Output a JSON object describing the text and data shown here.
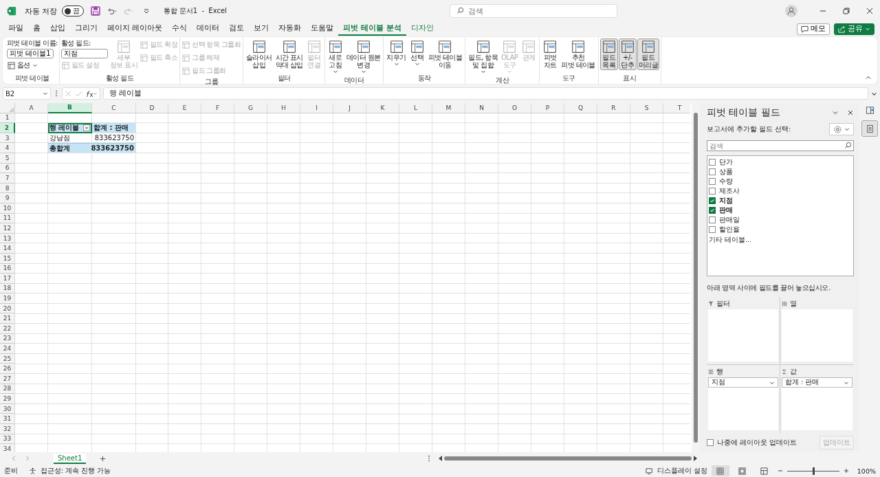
{
  "title_bar": {
    "autosave_label": "자동 저장",
    "autosave_state": "끔",
    "autosave_on": false,
    "document_title": "통합 문서1  -  Excel",
    "search_placeholder": "검색"
  },
  "menu_tabs": [
    {
      "label": "파일",
      "selected": false,
      "kind": "standard"
    },
    {
      "label": "홈",
      "selected": false,
      "kind": "standard"
    },
    {
      "label": "삽입",
      "selected": false,
      "kind": "standard"
    },
    {
      "label": "그리기",
      "selected": false,
      "kind": "standard"
    },
    {
      "label": "페이지 레이아웃",
      "selected": false,
      "kind": "standard"
    },
    {
      "label": "수식",
      "selected": false,
      "kind": "standard"
    },
    {
      "label": "데이터",
      "selected": false,
      "kind": "standard"
    },
    {
      "label": "검토",
      "selected": false,
      "kind": "standard"
    },
    {
      "label": "보기",
      "selected": false,
      "kind": "standard"
    },
    {
      "label": "자동화",
      "selected": false,
      "kind": "standard"
    },
    {
      "label": "도움말",
      "selected": false,
      "kind": "standard"
    },
    {
      "label": "피벗 테이블 분석",
      "selected": true,
      "kind": "contextual"
    },
    {
      "label": "디자인",
      "selected": false,
      "kind": "contextual"
    }
  ],
  "comment_button": "메모",
  "share_button": "공유",
  "ribbon_groups": [
    {
      "label": "피벗 테이블",
      "columns": [
        [
          {
            "kind": "field",
            "label": "피벗 테이블 이름:",
            "value": "피벗 테이블1"
          },
          {
            "kind": "small",
            "label": "옵션",
            "caret": true,
            "disabled": false
          }
        ]
      ]
    },
    {
      "label": "활성 필드",
      "columns": [
        [
          {
            "kind": "field",
            "label": "활성 필드:",
            "value": "지점"
          },
          {
            "kind": "small",
            "label": "필드 설정",
            "disabled": true
          }
        ],
        [
          {
            "kind": "large",
            "lines": [
              "세부",
              "정보 표시"
            ],
            "disabled": true,
            "pressed": false
          }
        ],
        [
          {
            "kind": "small",
            "label": "필드 확장",
            "disabled": true
          },
          {
            "kind": "small",
            "label": "필드 축소",
            "disabled": true
          }
        ]
      ]
    },
    {
      "label": "그룹",
      "columns": [
        [
          {
            "kind": "small",
            "label": "선택 항목 그룹화",
            "disabled": true
          },
          {
            "kind": "small",
            "label": "그룹 해제",
            "disabled": true
          },
          {
            "kind": "small",
            "label": "필드 그룹화",
            "disabled": true
          }
        ]
      ]
    },
    {
      "label": "필터",
      "columns": [
        [
          {
            "kind": "large",
            "lines": [
              "슬라이서",
              "삽입"
            ],
            "disabled": false,
            "pressed": false
          }
        ],
        [
          {
            "kind": "large",
            "lines": [
              "시간 표시",
              "막대 삽입"
            ],
            "disabled": false,
            "pressed": false
          }
        ],
        [
          {
            "kind": "large",
            "lines": [
              "필터",
              "연결"
            ],
            "disabled": true,
            "pressed": false
          }
        ]
      ]
    },
    {
      "label": "데이터",
      "columns": [
        [
          {
            "kind": "large",
            "lines": [
              "새로",
              "고침"
            ],
            "caret": true,
            "disabled": false,
            "pressed": false
          }
        ],
        [
          {
            "kind": "large",
            "lines": [
              "데이터 원본",
              "변경"
            ],
            "caret": true,
            "disabled": false,
            "pressed": false
          }
        ]
      ]
    },
    {
      "label": "동작",
      "columns": [
        [
          {
            "kind": "large",
            "lines": [
              "지우기"
            ],
            "caret": true,
            "disabled": false,
            "pressed": false
          }
        ],
        [
          {
            "kind": "large",
            "lines": [
              "선택"
            ],
            "caret": true,
            "disabled": false,
            "pressed": false
          }
        ],
        [
          {
            "kind": "large",
            "lines": [
              "피벗 테이블",
              "이동"
            ],
            "disabled": false,
            "pressed": false
          }
        ]
      ]
    },
    {
      "label": "계산",
      "columns": [
        [
          {
            "kind": "large",
            "lines": [
              "필드, 항목",
              "및 집합"
            ],
            "caret": true,
            "disabled": false,
            "pressed": false
          }
        ],
        [
          {
            "kind": "large",
            "lines": [
              "OLAP",
              "도구"
            ],
            "caret": true,
            "disabled": true,
            "pressed": false
          }
        ],
        [
          {
            "kind": "large",
            "lines": [
              "관계"
            ],
            "disabled": true,
            "pressed": false
          }
        ]
      ]
    },
    {
      "label": "도구",
      "columns": [
        [
          {
            "kind": "large",
            "lines": [
              "피벗",
              "차트"
            ],
            "disabled": false,
            "pressed": false
          }
        ],
        [
          {
            "kind": "large",
            "lines": [
              "추천",
              "피벗 테이블"
            ],
            "disabled": false,
            "pressed": false
          }
        ]
      ]
    },
    {
      "label": "표시",
      "columns": [
        [
          {
            "kind": "large",
            "lines": [
              "필드",
              "목록"
            ],
            "disabled": false,
            "pressed": true
          }
        ],
        [
          {
            "kind": "large",
            "lines": [
              "+/-",
              "단추"
            ],
            "disabled": false,
            "pressed": true
          }
        ],
        [
          {
            "kind": "large",
            "lines": [
              "필드",
              "머리글"
            ],
            "disabled": false,
            "pressed": true
          }
        ]
      ]
    }
  ],
  "formula_bar": {
    "name_box": "B2",
    "formula": "행 레이블"
  },
  "columns": [
    {
      "label": "A",
      "selected": false
    },
    {
      "label": "B",
      "selected": true
    },
    {
      "label": "C",
      "selected": false
    },
    {
      "label": "D",
      "selected": false
    },
    {
      "label": "E",
      "selected": false
    },
    {
      "label": "F",
      "selected": false
    },
    {
      "label": "G",
      "selected": false
    },
    {
      "label": "H",
      "selected": false
    },
    {
      "label": "I",
      "selected": false
    },
    {
      "label": "J",
      "selected": false
    },
    {
      "label": "K",
      "selected": false
    },
    {
      "label": "L",
      "selected": false
    },
    {
      "label": "M",
      "selected": false
    },
    {
      "label": "N",
      "selected": false
    },
    {
      "label": "O",
      "selected": false
    },
    {
      "label": "P",
      "selected": false
    },
    {
      "label": "Q",
      "selected": false
    },
    {
      "label": "R",
      "selected": false
    },
    {
      "label": "S",
      "selected": false
    },
    {
      "label": "T",
      "selected": false
    }
  ],
  "rows": [
    {
      "label": "1",
      "selected": false
    },
    {
      "label": "2",
      "selected": true
    },
    {
      "label": "3",
      "selected": false
    },
    {
      "label": "4",
      "selected": false
    },
    {
      "label": "5",
      "selected": false
    },
    {
      "label": "6",
      "selected": false
    },
    {
      "label": "7",
      "selected": false
    },
    {
      "label": "8",
      "selected": false
    },
    {
      "label": "9",
      "selected": false
    },
    {
      "label": "10",
      "selected": false
    },
    {
      "label": "11",
      "selected": false
    },
    {
      "label": "12",
      "selected": false
    },
    {
      "label": "13",
      "selected": false
    },
    {
      "label": "14",
      "selected": false
    },
    {
      "label": "15",
      "selected": false
    },
    {
      "label": "16",
      "selected": false
    },
    {
      "label": "17",
      "selected": false
    },
    {
      "label": "18",
      "selected": false
    },
    {
      "label": "19",
      "selected": false
    },
    {
      "label": "20",
      "selected": false
    },
    {
      "label": "21",
      "selected": false
    },
    {
      "label": "22",
      "selected": false
    },
    {
      "label": "23",
      "selected": false
    },
    {
      "label": "24",
      "selected": false
    },
    {
      "label": "25",
      "selected": false
    },
    {
      "label": "26",
      "selected": false
    },
    {
      "label": "27",
      "selected": false
    },
    {
      "label": "28",
      "selected": false
    },
    {
      "label": "29",
      "selected": false
    },
    {
      "label": "30",
      "selected": false
    },
    {
      "label": "31",
      "selected": false
    },
    {
      "label": "32",
      "selected": false
    },
    {
      "label": "33",
      "selected": false
    },
    {
      "label": "34",
      "selected": false
    }
  ],
  "pivot": {
    "header": [
      "행 레이블",
      "합계 : 판매"
    ],
    "rows": [
      [
        "강남점",
        "833623750"
      ]
    ],
    "total": [
      "총합계",
      "833623750"
    ]
  },
  "sheet_tabs": [
    {
      "label": "Sheet1",
      "selected": true
    }
  ],
  "field_pane": {
    "title": "피벗 테이블 필드",
    "subtitle": "보고서에 추가할 필드 선택:",
    "search_placeholder": "검색",
    "fields": [
      {
        "label": "단가",
        "checked": false
      },
      {
        "label": "상품",
        "checked": false
      },
      {
        "label": "수량",
        "checked": false
      },
      {
        "label": "제조사",
        "checked": false
      },
      {
        "label": "지점",
        "checked": true
      },
      {
        "label": "판매",
        "checked": true
      },
      {
        "label": "판매일",
        "checked": false
      },
      {
        "label": "할인율",
        "checked": false
      }
    ],
    "more_tables": "기타 테이블...",
    "hint": "아래 영역 사이에 필드를 끌어 놓으십시오.",
    "areas": [
      {
        "label": "필터",
        "kind": "filter"
      },
      {
        "label": "열",
        "kind": "columns"
      },
      {
        "label": "행",
        "kind": "rows",
        "items": [
          "지점"
        ]
      },
      {
        "label": "값",
        "kind": "values",
        "items": [
          "합계 : 판매"
        ]
      }
    ],
    "defer_label": "나중에 레이아웃 업데이트",
    "defer_checked": false,
    "update_button": "업데이트",
    "update_disabled": true
  },
  "status_bar": {
    "ready": "준비",
    "accessibility": "접근성: 계속 진행 가능",
    "display_settings": "디스플레이 설정",
    "zoom": {
      "level": 0.5,
      "reading": "100%"
    }
  }
}
